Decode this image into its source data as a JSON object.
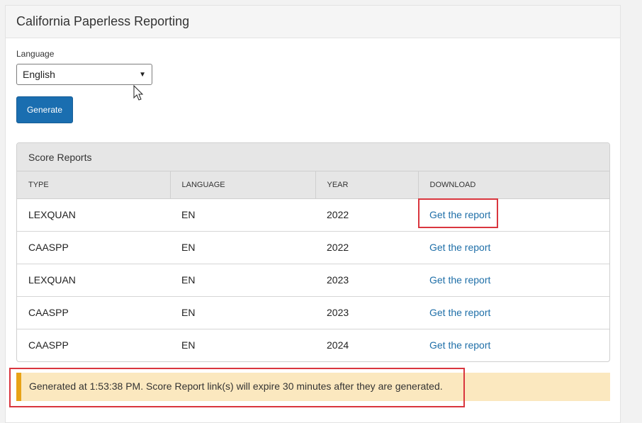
{
  "panel": {
    "title": "California Paperless Reporting"
  },
  "language": {
    "label": "Language",
    "selected": "English"
  },
  "generate_button": "Generate",
  "score_reports": {
    "title": "Score Reports",
    "columns": [
      "TYPE",
      "LANGUAGE",
      "YEAR",
      "DOWNLOAD"
    ],
    "rows": [
      {
        "type": "LEXQUAN",
        "language": "EN",
        "year": "2022",
        "download": "Get the report"
      },
      {
        "type": "CAASPP",
        "language": "EN",
        "year": "2022",
        "download": "Get the report"
      },
      {
        "type": "LEXQUAN",
        "language": "EN",
        "year": "2023",
        "download": "Get the report"
      },
      {
        "type": "CAASPP",
        "language": "EN",
        "year": "2023",
        "download": "Get the report"
      },
      {
        "type": "CAASPP",
        "language": "EN",
        "year": "2024",
        "download": "Get the report"
      }
    ]
  },
  "alert": {
    "text": "Generated at 1:53:38 PM. Score Report link(s) will expire 30 minutes after they are generated."
  },
  "colors": {
    "primary": "#1a6eb0",
    "link": "#1f6fa8",
    "alert_bg": "#fbe8bf",
    "alert_border": "#e8a317",
    "highlight": "#d9363e"
  }
}
